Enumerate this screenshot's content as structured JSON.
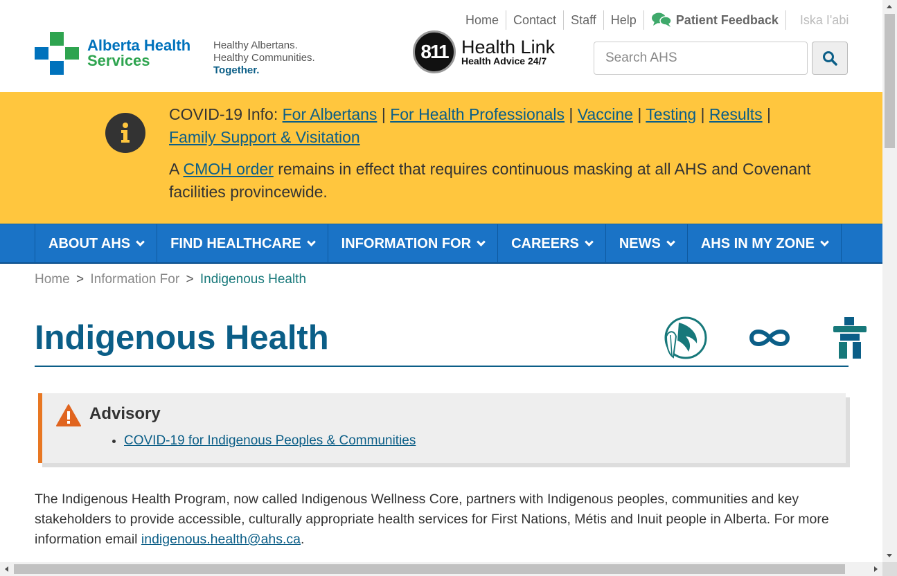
{
  "utility": {
    "home": "Home",
    "contact": "Contact",
    "staff": "Staff",
    "help": "Help",
    "feedback": "Patient Feedback",
    "lang": "Iska I'abi"
  },
  "logo": {
    "line1": "Alberta Health",
    "line2": "Services"
  },
  "tagline": {
    "line1": "Healthy Albertans.",
    "line2": "Healthy Communities.",
    "line3": "Together."
  },
  "healthlink": {
    "number": "811",
    "title": "Health Link",
    "subtitle": "Health Advice 24/7"
  },
  "search": {
    "placeholder": "Search AHS"
  },
  "covid": {
    "prefix": "COVID-19 Info:",
    "links": [
      "For Albertans",
      "For Health Professionals",
      "Vaccine",
      "Testing",
      "Results",
      "Family Support & Visitation"
    ],
    "sep": "|",
    "notice_pre": "A",
    "notice_link": "CMOH order",
    "notice_post": "remains in effect that requires continuous masking at all AHS and Covenant facilities provincewide."
  },
  "nav": [
    "ABOUT AHS",
    "FIND HEALTHCARE",
    "INFORMATION FOR",
    "CAREERS",
    "NEWS",
    "AHS IN MY ZONE"
  ],
  "breadcrumb": {
    "home": "Home",
    "mid": "Information For",
    "current": "Indigenous Health",
    "sep": ">"
  },
  "page": {
    "title": "Indigenous Health"
  },
  "advisory": {
    "heading": "Advisory",
    "link": "COVID-19 for Indigenous Peoples & Communities"
  },
  "body": {
    "text": "The Indigenous Health Program, now called Indigenous Wellness Core, partners with Indigenous peoples, communities and key stakeholders to provide accessible, culturally appropriate health services for First Nations, Métis and Inuit people in Alberta. For more information email",
    "email": "indigenous.health@ahs.ca",
    "end": "."
  },
  "colors": {
    "brand_blue": "#0b5e87",
    "nav_blue": "#1a73c6",
    "banner_yellow": "#ffc63e",
    "advisory_orange": "#e87722"
  }
}
